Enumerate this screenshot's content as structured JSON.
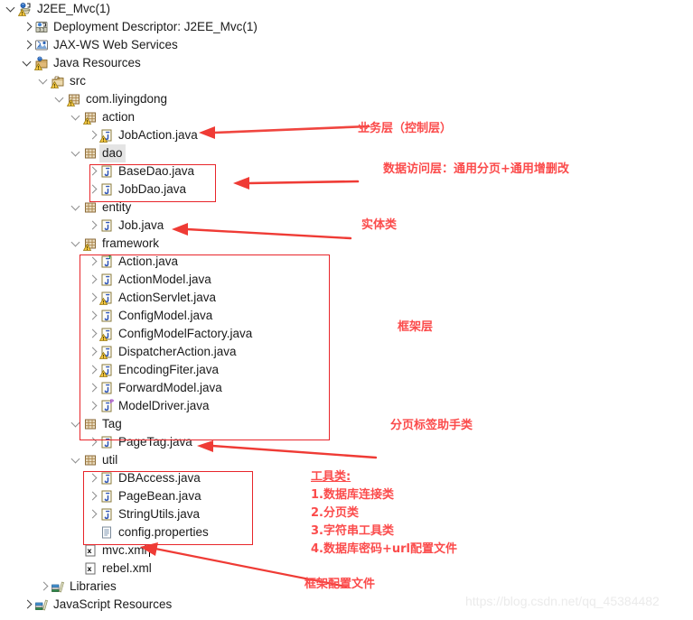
{
  "tree": {
    "rows": [
      {
        "label": "J2EE_Mvc(1)",
        "indent": 0,
        "twisty": "expanded",
        "icon": "j2ee-project-icon",
        "selected": false
      },
      {
        "label": "Deployment Descriptor: J2EE_Mvc(1)",
        "indent": 1,
        "twisty": "collapsed",
        "icon": "deployment-descriptor-icon",
        "selected": false
      },
      {
        "label": "JAX-WS Web Services",
        "indent": 1,
        "twisty": "collapsed",
        "icon": "jaxws-icon",
        "selected": false
      },
      {
        "label": "Java Resources",
        "indent": 1,
        "twisty": "expanded",
        "icon": "java-resources-icon",
        "selected": false
      },
      {
        "label": "src",
        "indent": 2,
        "twisty": "expanded",
        "icon": "source-folder-icon",
        "selected": false
      },
      {
        "label": "com.liyingdong",
        "indent": 3,
        "twisty": "expanded",
        "icon": "package-warning-icon",
        "selected": false
      },
      {
        "label": "action",
        "indent": 4,
        "twisty": "expanded",
        "icon": "package-warning-icon",
        "selected": false
      },
      {
        "label": "JobAction.java",
        "indent": 5,
        "twisty": "collapsed",
        "icon": "java-file-warning-icon",
        "selected": false
      },
      {
        "label": "dao",
        "indent": 4,
        "twisty": "expanded",
        "icon": "package-icon",
        "selected": true
      },
      {
        "label": "BaseDao.java",
        "indent": 5,
        "twisty": "collapsed",
        "icon": "java-file-icon",
        "selected": false
      },
      {
        "label": "JobDao.java",
        "indent": 5,
        "twisty": "collapsed",
        "icon": "java-file-icon",
        "selected": false
      },
      {
        "label": "entity",
        "indent": 4,
        "twisty": "expanded",
        "icon": "package-icon",
        "selected": false
      },
      {
        "label": "Job.java",
        "indent": 5,
        "twisty": "collapsed",
        "icon": "java-file-icon",
        "selected": false
      },
      {
        "label": "framework",
        "indent": 4,
        "twisty": "expanded",
        "icon": "package-warning-icon",
        "selected": false
      },
      {
        "label": "Action.java",
        "indent": 5,
        "twisty": "collapsed",
        "icon": "java-interface-icon",
        "selected": false
      },
      {
        "label": "ActionModel.java",
        "indent": 5,
        "twisty": "collapsed",
        "icon": "java-file-icon",
        "selected": false
      },
      {
        "label": "ActionServlet.java",
        "indent": 5,
        "twisty": "collapsed",
        "icon": "java-file-warning-icon",
        "selected": false
      },
      {
        "label": "ConfigModel.java",
        "indent": 5,
        "twisty": "collapsed",
        "icon": "java-file-icon",
        "selected": false
      },
      {
        "label": "ConfigModelFactory.java",
        "indent": 5,
        "twisty": "collapsed",
        "icon": "java-file-warning-icon",
        "selected": false
      },
      {
        "label": "DispatcherAction.java",
        "indent": 5,
        "twisty": "collapsed",
        "icon": "java-file-warning-icon",
        "selected": false
      },
      {
        "label": "EncodingFiter.java",
        "indent": 5,
        "twisty": "collapsed",
        "icon": "java-file-warning-icon",
        "selected": false
      },
      {
        "label": "ForwardModel.java",
        "indent": 5,
        "twisty": "collapsed",
        "icon": "java-file-icon",
        "selected": false
      },
      {
        "label": "ModelDriver.java",
        "indent": 5,
        "twisty": "collapsed",
        "icon": "java-generic-icon",
        "selected": false
      },
      {
        "label": "Tag",
        "indent": 4,
        "twisty": "expanded",
        "icon": "package-icon",
        "selected": false
      },
      {
        "label": "PageTag.java",
        "indent": 5,
        "twisty": "collapsed",
        "icon": "java-file-icon",
        "selected": false
      },
      {
        "label": "util",
        "indent": 4,
        "twisty": "expanded",
        "icon": "package-icon",
        "selected": false
      },
      {
        "label": "DBAccess.java",
        "indent": 5,
        "twisty": "collapsed",
        "icon": "java-file-icon",
        "selected": false
      },
      {
        "label": "PageBean.java",
        "indent": 5,
        "twisty": "collapsed",
        "icon": "java-file-icon",
        "selected": false
      },
      {
        "label": "StringUtils.java",
        "indent": 5,
        "twisty": "collapsed",
        "icon": "java-file-icon",
        "selected": false
      },
      {
        "label": "config.properties",
        "indent": 5,
        "twisty": "none",
        "icon": "properties-file-icon",
        "selected": false
      },
      {
        "label": "mvc.xml",
        "indent": 4,
        "twisty": "none",
        "icon": "xml-file-icon",
        "selected": false,
        "caret": true
      },
      {
        "label": "rebel.xml",
        "indent": 4,
        "twisty": "none",
        "icon": "xml-file-icon",
        "selected": false
      },
      {
        "label": "Libraries",
        "indent": 2,
        "twisty": "collapsed",
        "icon": "libraries-icon",
        "selected": false
      },
      {
        "label": "JavaScript Resources",
        "indent": 1,
        "twisty": "collapsed",
        "icon": "libraries-icon",
        "selected": false
      }
    ]
  },
  "annotations": {
    "business_layer": "业务层（控制层）",
    "data_access_layer": "数据访问层：通用分页+通用增删改",
    "entity_class": "实体类",
    "framework_layer": "框架层",
    "page_tag_helper": "分页标签助手类",
    "util_title": "工具类:",
    "util_item_1": "1.数据库连接类",
    "util_item_2": "2.分页类",
    "util_item_3": "3.字符串工具类",
    "util_item_4": "4.数据库密码+url配置文件",
    "framework_config_file": "框架配置文件"
  },
  "watermark": {
    "text": "https://blog.csdn.net/qq_45384482"
  },
  "colors": {
    "annotation_red": "#fb4b4b",
    "box_red": "#e8252a",
    "arrow_red": "#ef3b35",
    "selection_grey": "#e4e4e4",
    "java_icon_blue": "#3f68c4"
  }
}
